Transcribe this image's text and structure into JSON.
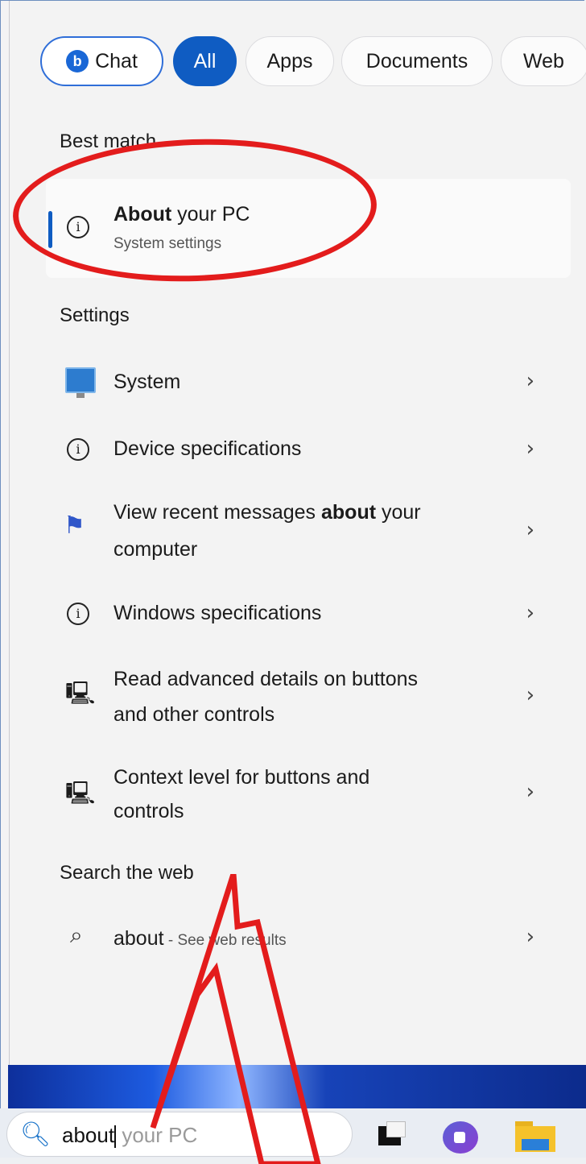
{
  "filters": {
    "chat": "Chat",
    "all": "All",
    "apps": "Apps",
    "documents": "Documents",
    "web": "Web"
  },
  "best_match": {
    "heading": "Best match",
    "title_bold": "About",
    "title_rest": " your PC",
    "subtitle": "System settings"
  },
  "settings": {
    "heading": "Settings",
    "items": [
      {
        "line1": "System",
        "line2": "",
        "icon": "system-icon"
      },
      {
        "line1": "Device specifications",
        "line2": "",
        "icon": "info-icon"
      },
      {
        "line1_pre": "View recent messages ",
        "line1_bold": "about",
        "line1_post": " your",
        "line2": "computer",
        "icon": "flag-icon"
      },
      {
        "line1": "Windows specifications",
        "line2": "",
        "icon": "info-icon"
      },
      {
        "line1": "Read advanced details on buttons",
        "line2": "and other controls",
        "icon": "monitor-settings-icon"
      },
      {
        "line1": "Context level for buttons and",
        "line2": "controls",
        "icon": "monitor-settings-icon"
      }
    ]
  },
  "web": {
    "heading": "Search the web",
    "query": "about",
    "suffix": " - See web results"
  },
  "taskbar": {
    "typed": "about",
    "hint": "your PC"
  }
}
